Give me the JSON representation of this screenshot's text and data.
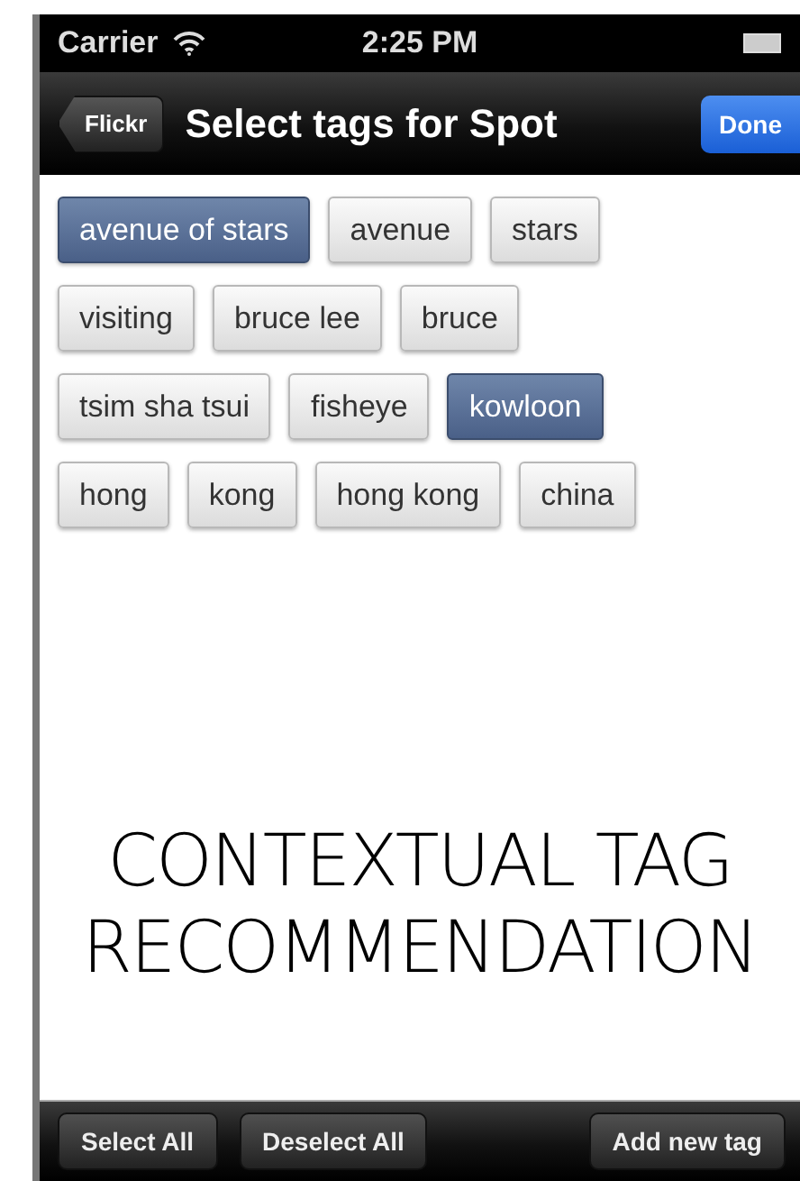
{
  "status_bar": {
    "carrier": "Carrier",
    "time": "2:25 PM"
  },
  "nav_bar": {
    "back": "Flickr",
    "title": "Select tags for Spot",
    "done": "Done"
  },
  "tag_rows": [
    [
      {
        "label": "avenue of stars",
        "selected": true
      },
      {
        "label": "avenue",
        "selected": false
      },
      {
        "label": "stars",
        "selected": false
      }
    ],
    [
      {
        "label": "visiting",
        "selected": false
      },
      {
        "label": "bruce lee",
        "selected": false
      },
      {
        "label": "bruce",
        "selected": false
      }
    ],
    [
      {
        "label": "tsim sha tsui",
        "selected": false
      },
      {
        "label": "fisheye",
        "selected": false
      },
      {
        "label": "kowloon",
        "selected": true
      }
    ],
    [
      {
        "label": "hong",
        "selected": false
      },
      {
        "label": "kong",
        "selected": false
      },
      {
        "label": "hong kong",
        "selected": false
      },
      {
        "label": "china",
        "selected": false
      }
    ]
  ],
  "caption": [
    "CONTEXTUAL TAG",
    "RECOMMENDATION"
  ],
  "toolbar": {
    "left": [
      "Select All",
      "Deselect All"
    ],
    "right": "Add new tag"
  }
}
